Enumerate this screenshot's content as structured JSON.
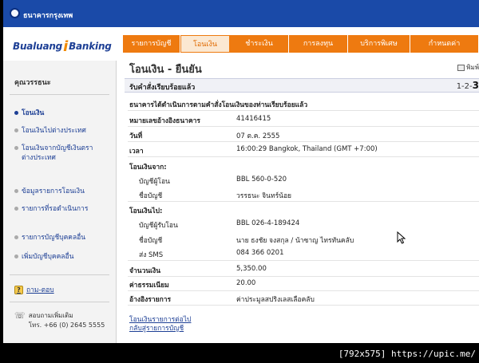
{
  "header": {
    "bank_name": "ธนาคารกรุงเทพ"
  },
  "brand": {
    "part1": "Bualuang",
    "part2": "i",
    "part3": "Banking"
  },
  "nav": {
    "items": [
      {
        "label": "รายการบัญชี",
        "active": false
      },
      {
        "label": "โอนเงิน",
        "active": true
      },
      {
        "label": "ชำระเงิน",
        "active": false
      },
      {
        "label": "การลงทุน",
        "active": false
      },
      {
        "label": "บริการพิเศษ",
        "active": false
      },
      {
        "label": "กำหนดค่า",
        "active": false
      }
    ]
  },
  "sidebar": {
    "title": "คุณวรรธนะ",
    "items": [
      {
        "label": "โอนเงิน",
        "current": true
      },
      {
        "label": "โอนเงินไปต่างประเทศ",
        "current": false
      },
      {
        "label": "โอนเงินจากบัญชีเงินตราต่างประเทศ",
        "current": false
      },
      {
        "label": "ข้อมูลรายการโอนเงิน",
        "current": false
      },
      {
        "label": "รายการที่รอดำเนินการ",
        "current": false
      },
      {
        "label": "รายการบัญชีบุคคลอื่น",
        "current": false
      },
      {
        "label": "เพิ่มบัญชีบุคคลอื่น",
        "current": false
      }
    ],
    "help": "ถาม-ตอบ",
    "contact_line1": "สอบถามเพิ่มเติม",
    "contact_line2": "โทร. +66 (0) 2645 5555"
  },
  "main": {
    "title": "โอนเงิน - ยืนยัน",
    "print_label": "พิมพ์",
    "banner": "รับคำสั่งเรียบร้อยแล้ว",
    "steps": "1-2-",
    "step_current": "3",
    "confirm_text": "ธนาคารได้ดำเนินการตามคำสั่งโอนเงินของท่านเรียบร้อยแล้ว",
    "details": {
      "ref_label": "หมายเลขอ้างอิงธนาคาร",
      "ref_value": "41416415",
      "date_label": "วันที่",
      "date_value": "07 ต.ค. 2555",
      "time_label": "เวลา",
      "time_value": "16:00:29 Bangkok, Thailand (GMT +7:00)",
      "from_label": "โอนเงินจาก:",
      "from_acct_label": "บัญชีผู้โอน",
      "from_acct_value": "BBL 560-0-520",
      "from_name_label": "ชื่อบัญชี",
      "from_name_value": "วรรธนะ จินทร์น้อย",
      "to_label": "โอนเงินไป:",
      "to_acct_label": "บัญชีผู้รับโอน",
      "to_acct_value": "BBL 026-4-189424",
      "to_name_label": "ชื่อบัญชี",
      "to_name_value": "นาย ธงชัย จงสกุล / น้าซาญ ไทรทันคลับ",
      "sms_label": "ส่ง SMS",
      "sms_value": "084 366 0201",
      "amount_label": "จำนวนเงิน",
      "amount_value": "5,350.00",
      "fee_label": "ค่าธรรมเนียม",
      "fee_value": "20.00",
      "memo_label": "อ้างอิงรายการ",
      "memo_value": "ค่าประมูลสปริงเลสเลือคลับ"
    },
    "link_next": "โอนเงินรายการต่อไป",
    "link_back": "กลับสู่รายการบัญชี"
  },
  "watermark": "[792x575] https://upic.me/"
}
